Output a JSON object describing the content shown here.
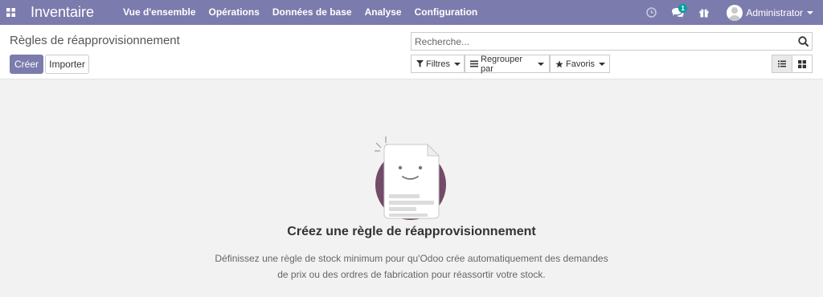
{
  "navbar": {
    "app_name": "Inventaire",
    "menu": [
      "Vue d'ensemble",
      "Opérations",
      "Données de base",
      "Analyse",
      "Configuration"
    ],
    "chat_badge": "1",
    "user_name": "Administrator",
    "color": "#7c7bad"
  },
  "control_panel": {
    "breadcrumb": "Règles de réapprovisionnement",
    "create_label": "Créer",
    "import_label": "Importer",
    "search_placeholder": "Recherche...",
    "filters_label": "Filtres",
    "groupby_label": "Regrouper par",
    "favorites_label": "Favoris",
    "active_view": "list"
  },
  "empty_state": {
    "title": "Créez une règle de réapprovisionnement",
    "text": "Définissez une règle de stock minimum pour qu'Odoo crée automatiquement des demandes de prix ou des ordres de fabrication pour réassortir votre stock."
  },
  "icons": [
    "apps-icon",
    "clock-icon",
    "chat-icon",
    "gift-icon",
    "search-icon",
    "filter-icon",
    "bars-icon",
    "star-icon",
    "list-view-icon",
    "kanban-view-icon"
  ]
}
